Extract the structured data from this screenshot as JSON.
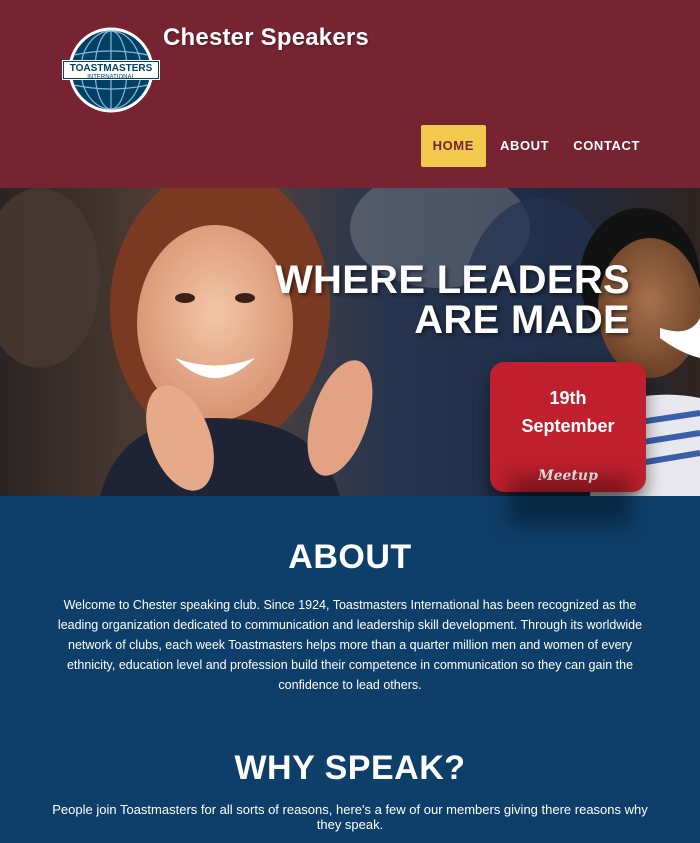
{
  "header": {
    "logo_text_top": "TOASTMASTERS",
    "logo_text_bottom": "INTERNATIONAL",
    "site_title": "Chester Speakers",
    "nav": [
      {
        "label": "HOME",
        "active": true
      },
      {
        "label": "ABOUT",
        "active": false
      },
      {
        "label": "CONTACT",
        "active": false
      }
    ]
  },
  "hero": {
    "headline_line1": "WHERE LEADERS",
    "headline_line2": "ARE MADE",
    "event": {
      "day": "19th",
      "month": "September",
      "brand": "Meetup"
    }
  },
  "about": {
    "title": "ABOUT",
    "body": "Welcome to Chester speaking club. Since 1924, Toastmasters International has been recognized as the leading organization dedicated to communication and leadership skill development. Through its worldwide network of clubs, each week Toastmasters helps more than a quarter million men and women of every ethnicity, education level and profession build their competence in communication so they can gain the confidence to lead others."
  },
  "why_speak": {
    "title": "WHY SPEAK?",
    "body": "People join Toastmasters for all sorts of reasons, here's a few of our members giving there reasons why they speak."
  },
  "colors": {
    "header_bg": "#772432",
    "nav_active_bg": "#f2c94c",
    "event_card_bg": "#c0202e",
    "content_bg": "#0e3f6a"
  }
}
